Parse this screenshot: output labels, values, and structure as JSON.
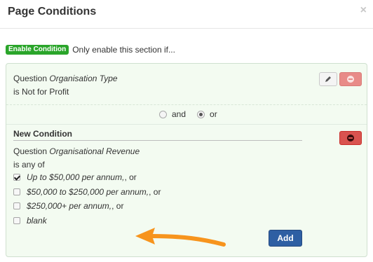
{
  "dialog": {
    "title": "Page Conditions",
    "close_label": "×"
  },
  "enable": {
    "badge_label": "Enable Condition",
    "description": "Only enable this section if..."
  },
  "condition_1": {
    "question_prefix": "Question",
    "question_name": "Organisation Type",
    "rule": "is Not for Profit"
  },
  "combinator": {
    "and_label": "and",
    "or_label": "or",
    "selected": "or"
  },
  "new_condition": {
    "heading": "New Condition",
    "question_prefix": "Question",
    "question_name": "Organisational Revenue",
    "operator": "is any of",
    "options": [
      {
        "label": "Up to $50,000 per annum,",
        "suffix": ", or",
        "checked": true
      },
      {
        "label": "$50,000 to $250,000 per annum,",
        "suffix": ", or",
        "checked": false
      },
      {
        "label": "$250,000+ per annum,",
        "suffix": ", or",
        "checked": false
      },
      {
        "label": "blank",
        "suffix": "",
        "checked": false
      }
    ],
    "add_label": "Add"
  },
  "colors": {
    "enable_badge": "#2aa52a",
    "panel_bg": "#f3fbf1",
    "remove_button": "#d9534f",
    "add_button": "#2e5fa3",
    "annotation_arrow": "#f7941d"
  },
  "icons": {
    "edit": "pencil-icon",
    "remove": "minus-circle-icon",
    "close": "close-icon"
  }
}
